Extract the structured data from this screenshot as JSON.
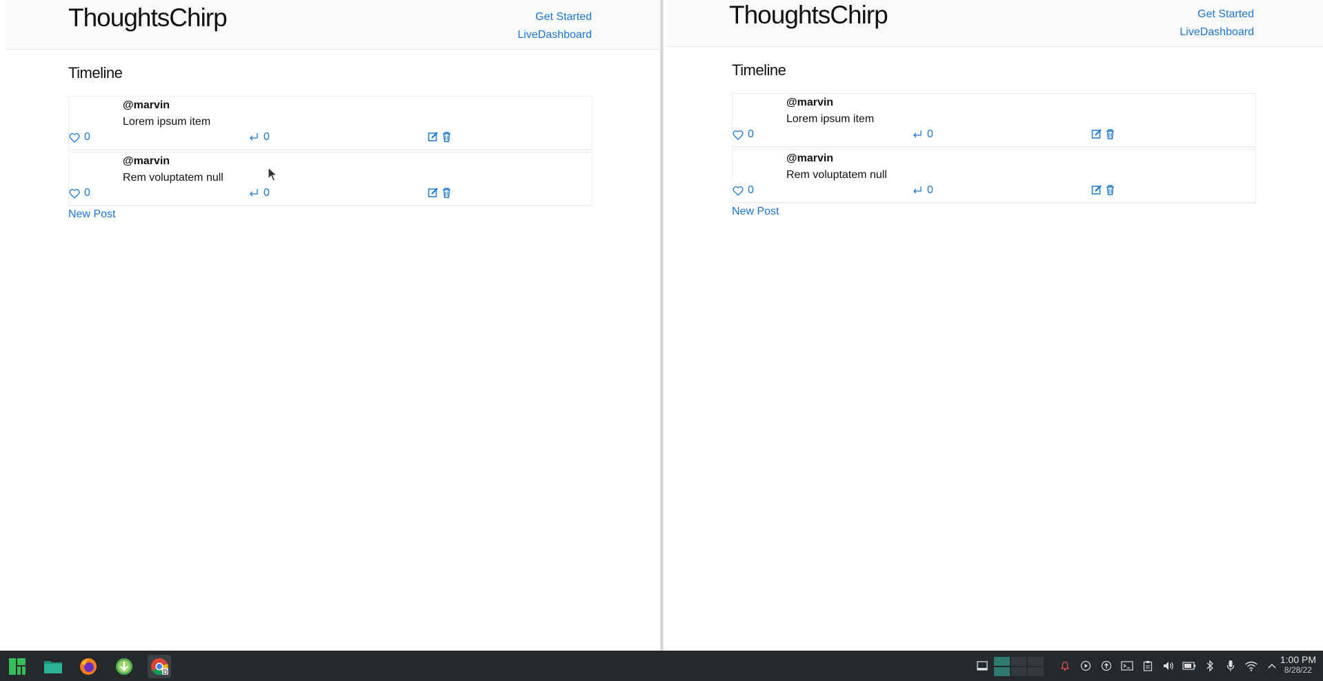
{
  "brand": "ThoughtsChirp",
  "nav": {
    "get_started": "Get Started",
    "live_dashboard": "LiveDashboard"
  },
  "timeline": {
    "title": "Timeline",
    "posts": [
      {
        "author": "@marvin",
        "body": "Lorem ipsum item",
        "likes": "0",
        "reposts": "0"
      },
      {
        "author": "@marvin",
        "body": "Rem voluptatem null",
        "likes": "0",
        "reposts": "0"
      }
    ],
    "new_post": "New Post"
  },
  "taskbar": {
    "apps": [
      "start-menu",
      "file-manager",
      "firefox",
      "downloader",
      "chrome"
    ],
    "clock_time": "1:00 PM",
    "clock_date": "8/28/22"
  },
  "colors": {
    "link": "#1976d2",
    "taskbar": "#26292c",
    "header": "#fafafa"
  }
}
